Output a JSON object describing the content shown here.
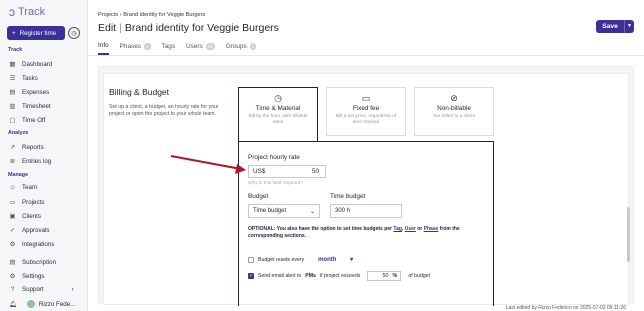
{
  "app": {
    "name": "Track",
    "register_label": "Register time"
  },
  "nav": {
    "sections": [
      {
        "title": "Track",
        "items": [
          "Dashboard",
          "Tasks",
          "Expenses",
          "Timesheet",
          "Time Off"
        ]
      },
      {
        "title": "Analyze",
        "items": [
          "Reports",
          "Entries log"
        ]
      },
      {
        "title": "Manage",
        "items": [
          "Team",
          "Projects",
          "Clients",
          "Approvals",
          "Integrations"
        ]
      }
    ],
    "extra": [
      "Subscription",
      "Settings",
      "Support"
    ],
    "user_name": "Rizzo Fede..."
  },
  "breadcrumb": {
    "root": "Projects",
    "current": "Brand identity for Veggie Burgers"
  },
  "page": {
    "prefix": "Edit",
    "title": "Brand identity for Veggie Burgers"
  },
  "actions": {
    "save": "Save"
  },
  "tabs": [
    {
      "label": "Info",
      "count": null
    },
    {
      "label": "Phases",
      "count": "2"
    },
    {
      "label": "Tags",
      "count": null
    },
    {
      "label": "Users",
      "count": "10"
    },
    {
      "label": "Groups",
      "count": "1"
    }
  ],
  "billing": {
    "title": "Billing & Budget",
    "description": "Set up a client, a budget, an hourly rate for your project or open the project to your whole team.",
    "options": [
      {
        "title": "Time & Material",
        "desc": "Bill by the hour, with billable rates",
        "icon": "clock-icon"
      },
      {
        "title": "Fixed fee",
        "desc": "Bill a set price, regardless of time tracked",
        "icon": "money-icon"
      },
      {
        "title": "Non-billable",
        "desc": "Not billed to a client",
        "icon": "no-money-icon"
      }
    ],
    "rate_label": "Project hourly rate",
    "currency": "US$",
    "rate_value": "50",
    "why_link": "Why is this field required?",
    "budget_label": "Budget",
    "budget_value": "Time budget",
    "time_budget_label": "Time budget",
    "time_budget_value": "300 h",
    "optional_prefix": "OPTIONAL: You also have the option to set time budgets per",
    "optional_tags": "Tag",
    "optional_user": "User",
    "optional_or": "or",
    "optional_phase": "Phase",
    "optional_suffix": "from the corresponding sections.",
    "resets_label": "Budget resets every",
    "resets_value": "month",
    "alert_prefix": "Send email alert to",
    "alert_pms": "PMs",
    "alert_mid": "if project exceeds",
    "alert_value": "50",
    "alert_unit": "%",
    "alert_suffix": "of budget"
  },
  "footer": {
    "last_edited": "Last edited by Rizzo Federico on 2025-07-03 09:11:26"
  },
  "colors": {
    "accent": "#3b2f9a",
    "arrow": "#b0152b"
  }
}
